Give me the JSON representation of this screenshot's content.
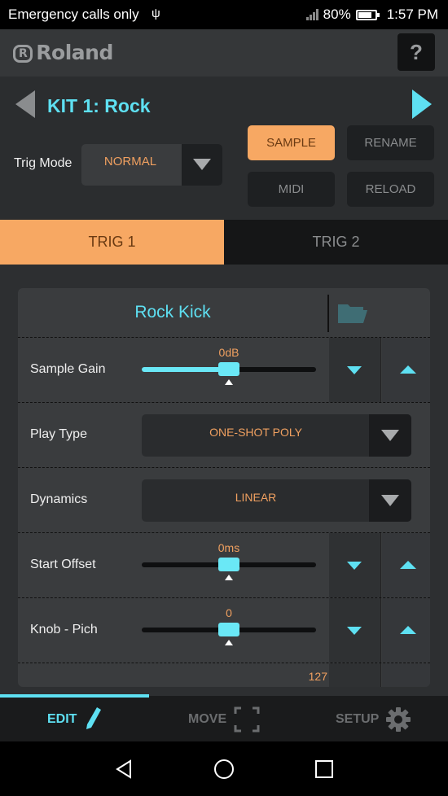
{
  "status_bar": {
    "carrier_text": "Emergency calls only",
    "battery": "80%",
    "battery_level": 0.8,
    "time": "1:57 PM"
  },
  "header": {
    "logo_text": "Roland",
    "help_label": "?"
  },
  "kit": {
    "title": "KIT 1: Rock",
    "trig_mode_label": "Trig Mode",
    "trig_mode_value": "NORMAL"
  },
  "buttons": {
    "sample": "SAMPLE",
    "rename": "RENAME",
    "midi": "MIDI",
    "reload": "RELOAD"
  },
  "tabs": {
    "trig1": "TRIG 1",
    "trig2": "TRIG 2"
  },
  "panel": {
    "sample_name": "Rock Kick",
    "rows": [
      {
        "label": "Sample Gain",
        "value": "0dB",
        "level": 0.5
      },
      {
        "label": "Play Type",
        "value": "ONE-SHOT POLY"
      },
      {
        "label": "Dynamics",
        "value": "LINEAR"
      },
      {
        "label": "Start Offset",
        "value": "0ms",
        "level": 0.5
      },
      {
        "label": "Knob - Pich",
        "value": "0",
        "level": 0.5
      },
      {
        "label": "",
        "value": "127"
      }
    ]
  },
  "bottom_tabs": {
    "edit": "EDIT",
    "move": "MOVE",
    "setup": "SETUP"
  },
  "colors": {
    "accent_cyan": "#5ee0f2",
    "accent_orange": "#f7a863",
    "value_orange": "#f0a060"
  }
}
